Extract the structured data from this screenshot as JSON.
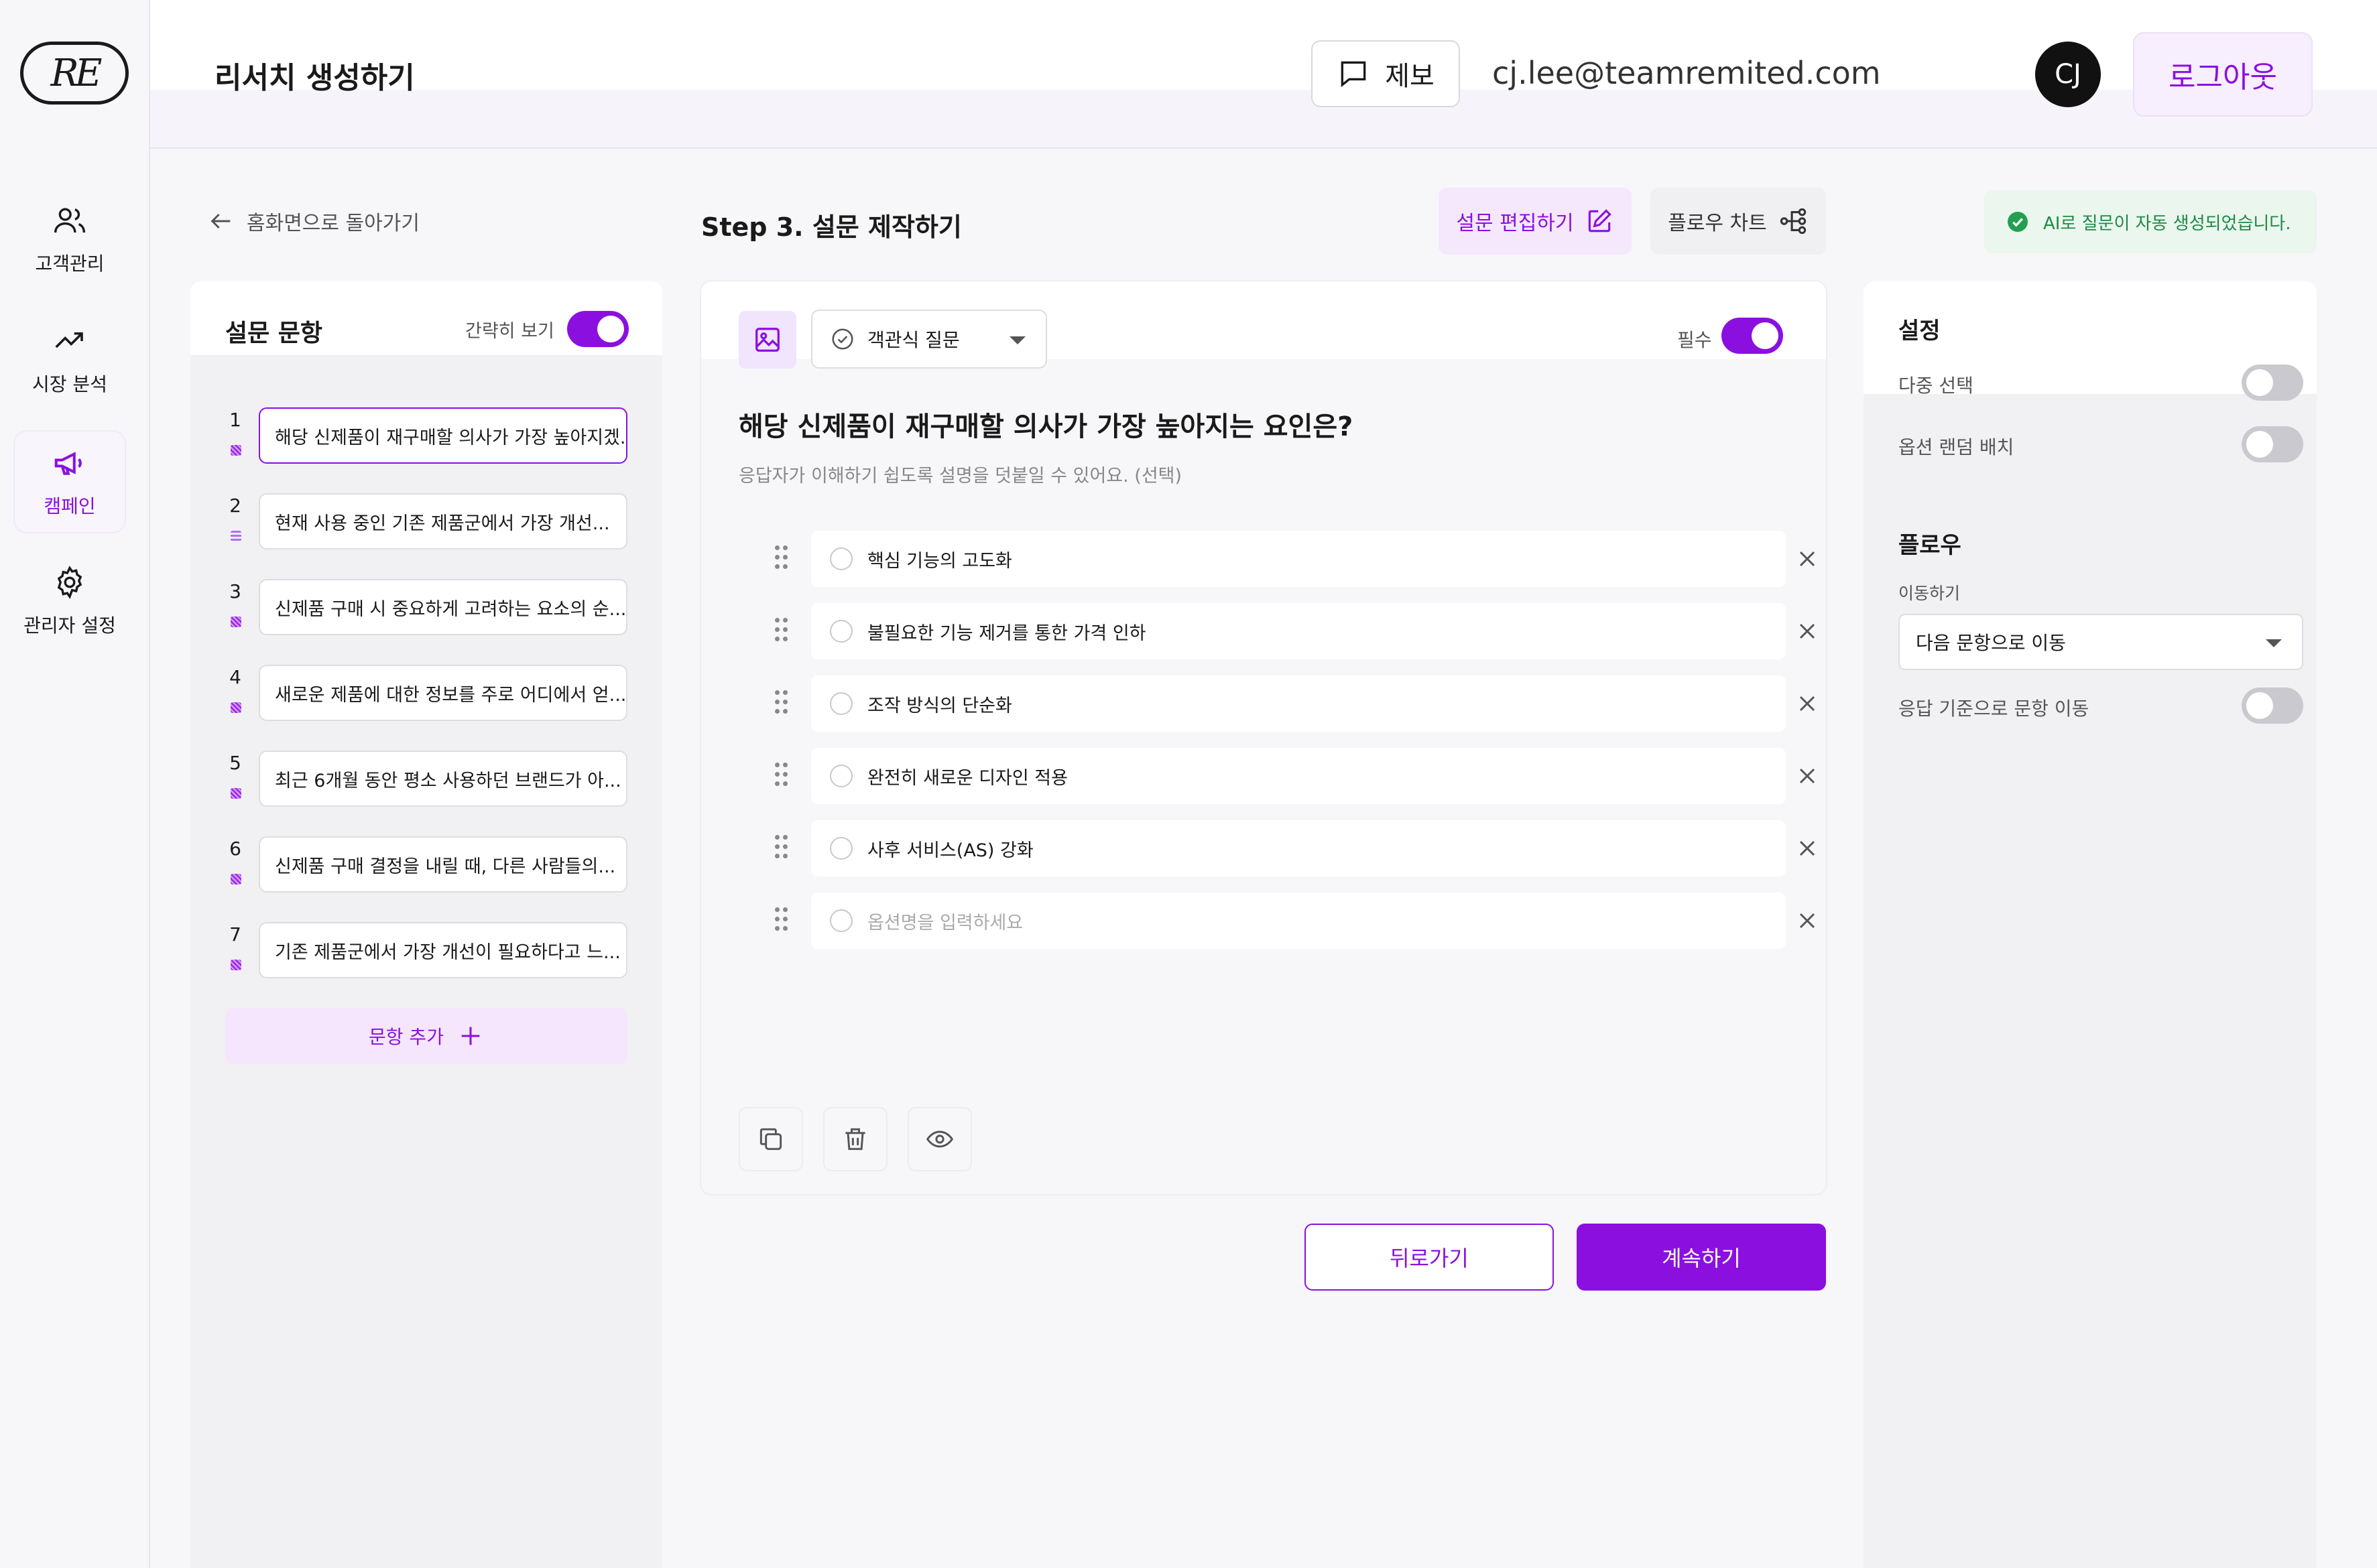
{
  "header": {
    "title": "리서치 생성하기",
    "report_label": "제보",
    "email": "cj.lee@teamremited.com",
    "avatar_initials": "CJ",
    "logout_label": "로그아웃"
  },
  "sidebar": {
    "logo_text": "RE",
    "items": [
      {
        "label": "고객관리",
        "icon": "users-icon",
        "active": false
      },
      {
        "label": "시장 분석",
        "icon": "trend-up-icon",
        "active": false
      },
      {
        "label": "캠페인",
        "icon": "megaphone-icon",
        "active": true
      },
      {
        "label": "관리자 설정",
        "icon": "gear-icon",
        "active": false
      }
    ]
  },
  "toolbar": {
    "back_home": "홈화면으로 돌아가기",
    "step_title": "Step 3. 설문 제작하기",
    "edit_label": "설문 편집하기",
    "flow_chart_label": "플로우 차트",
    "toast": "AI로 질문이 자동 생성되었습니다."
  },
  "question_list": {
    "title": "설문 문항",
    "simple_view_label": "간략히 보기",
    "simple_view_on": true,
    "questions": [
      {
        "num": "1",
        "type": "choice",
        "text": "해당 신제품이 재구매할 의사가 가장 높아지겠..."
      },
      {
        "num": "2",
        "type": "text",
        "text": "현재 사용 중인 기존 제품군에서 가장 개선..."
      },
      {
        "num": "3",
        "type": "choice",
        "text": "신제품 구매 시 중요하게 고려하는 요소의 순..."
      },
      {
        "num": "4",
        "type": "choice",
        "text": "새로운 제품에 대한 정보를 주로 어디에서 얻..."
      },
      {
        "num": "5",
        "type": "choice",
        "text": "최근 6개월 동안 평소 사용하던 브랜드가 아..."
      },
      {
        "num": "6",
        "type": "choice",
        "text": "신제품 구매 결정을 내릴 때, 다른 사람들의..."
      },
      {
        "num": "7",
        "type": "choice",
        "text": "기존 제품군에서 가장 개선이 필요하다고 느..."
      }
    ],
    "add_label": "문항 추가"
  },
  "editor": {
    "question_type": "객관식 질문",
    "required_label": "필수",
    "required_on": true,
    "question_title": "해당 신제품이 재구매할 의사가 가장 높아지는 요인은?",
    "description_placeholder": "응답자가 이해하기 쉽도록 설명을 덧붙일 수 있어요. (선택)",
    "options": [
      "핵심 기능의 고도화",
      "불필요한 기능 제거를 통한 가격 인하",
      "조작 방식의 단순화",
      "완전히 새로운 디자인 적용",
      "사후 서비스(AS) 강화"
    ],
    "option_placeholder": "옵션명을 입력하세요"
  },
  "footer": {
    "back_label": "뒤로가기",
    "next_label": "계속하기"
  },
  "settings": {
    "title": "설정",
    "multi_select_label": "다중 선택",
    "multi_select_on": false,
    "random_order_label": "옵션 랜덤 배치",
    "random_order_on": false,
    "flow_title": "플로우",
    "move_label": "이동하기",
    "move_value": "다음 문항으로 이동",
    "answer_based_label": "응답 기준으로 문항 이동",
    "answer_based_on": false
  },
  "colors": {
    "accent": "#8b10e0",
    "accent_soft": "#f5e8fd",
    "success": "#1e8a43"
  }
}
